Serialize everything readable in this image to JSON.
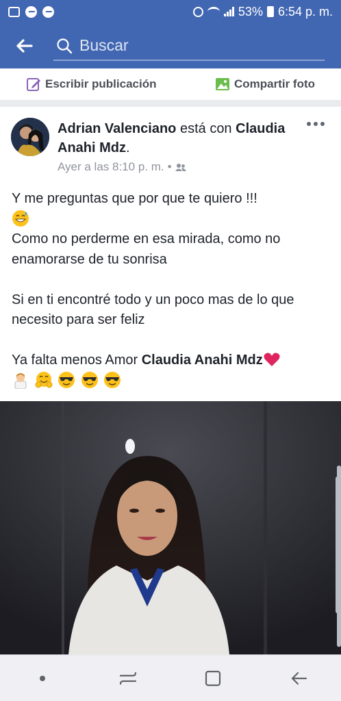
{
  "status_bar": {
    "battery": "53%",
    "time": "6:54 p. m.",
    "icons": [
      "gallery-icon",
      "messenger-icon",
      "messenger-icon",
      "alarm-icon",
      "wifi-icon",
      "signal-icon",
      "battery-icon"
    ]
  },
  "search": {
    "placeholder": "Buscar"
  },
  "composer": {
    "write_label": "Escribir publicación",
    "photo_label": "Compartir foto"
  },
  "post": {
    "author": "Adrian Valenciano",
    "with_text": "está con",
    "tagged": "Claudia Anahi Mdz",
    "period": ".",
    "timestamp": "Ayer a las 8:10 p. m.",
    "separator": "•",
    "line1": "Y me preguntas   que por que te quiero !!!",
    "line2": "Como no perderme en esa mirada, como no enamorarse de tu sonrisa",
    "line3": "Si en ti encontré todo y  un poco mas de lo que necesito para ser feliz",
    "line4_prefix": "Ya falta menos Amor  ",
    "line4_tag": "Claudia Anahi Mdz",
    "emojis_line": [
      "man-icon",
      "hugging-face-icon",
      "sunglasses-face-icon",
      "sunglasses-face-icon",
      "sunglasses-face-icon"
    ]
  },
  "colors": {
    "brand": "#4267b2",
    "text": "#1d2129",
    "meta": "#90949c"
  }
}
